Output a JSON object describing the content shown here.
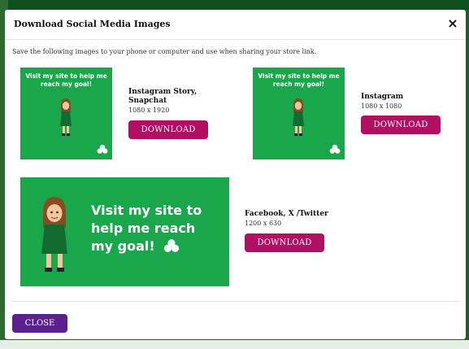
{
  "modal": {
    "title": "Download Social Media Images",
    "close_icon": "×",
    "intro": "Save the following images to your phone or computer and use when sharing your store link."
  },
  "thumbnail_text": "Visit my site to help me reach my goal!",
  "banner_text_lines": [
    "Visit my site to",
    "help me reach",
    "my goal!"
  ],
  "items": [
    {
      "title_lines": [
        "Instagram Story,",
        "Snapchat"
      ],
      "size": "1080 x 1920",
      "button": "DOWNLOAD"
    },
    {
      "title_lines": [
        "Instagram"
      ],
      "size": "1080 x 1080",
      "button": "DOWNLOAD"
    },
    {
      "title_lines": [
        "Facebook, X /Twitter"
      ],
      "size": "1200 x 630",
      "button": "DOWNLOAD"
    }
  ],
  "footer": {
    "close_label": "CLOSE"
  },
  "colors": {
    "thumb_green": "#1aa64b",
    "download_button": "#b10f62",
    "close_button": "#5b1f8f"
  },
  "icons": [
    "close-icon",
    "trefoil-icon",
    "girl-avatar-icon"
  ]
}
